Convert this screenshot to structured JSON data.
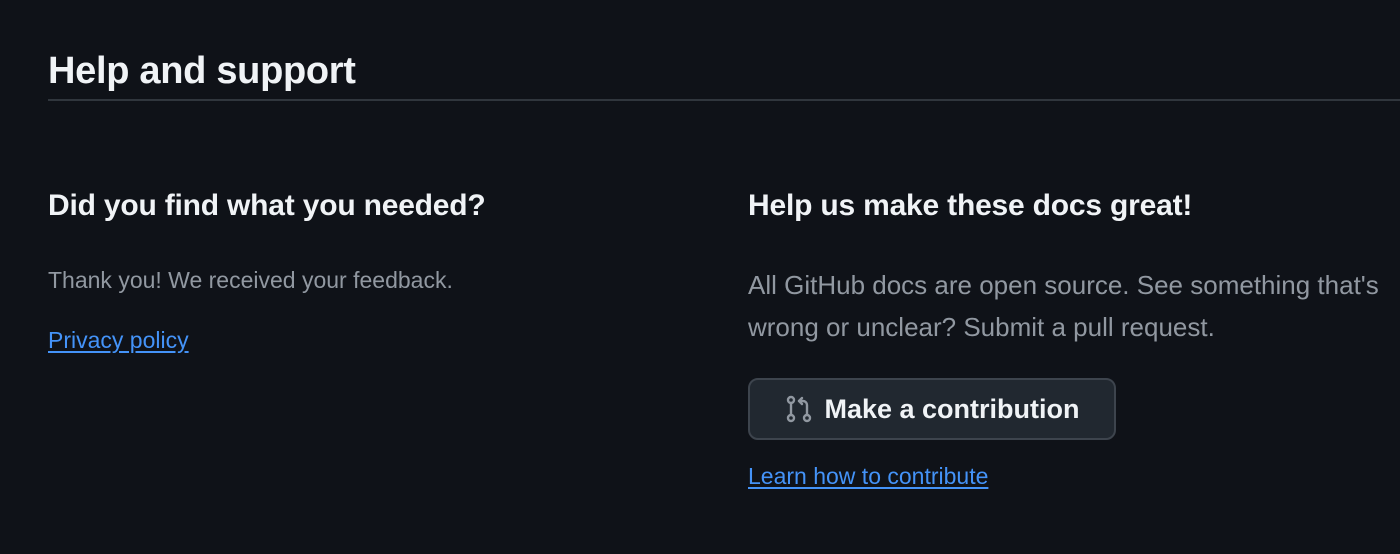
{
  "section": {
    "title": "Help and support"
  },
  "feedback": {
    "heading": "Did you find what you needed?",
    "message": "Thank you! We received your feedback.",
    "privacy_link": "Privacy policy"
  },
  "contribute": {
    "heading": "Help us make these docs great!",
    "description": "All GitHub docs are open source. See something that's wrong or unclear? Submit a pull request.",
    "button_label": "Make a contribution",
    "button_icon": "git-pull-request-icon",
    "learn_link": "Learn how to contribute"
  },
  "colors": {
    "background": "#0f1218",
    "text_primary": "#f0f3f6",
    "text_muted": "#9198a1",
    "link": "#4493f8",
    "button_bg": "#212830",
    "button_border": "#3d444d",
    "divider": "#30363d"
  }
}
